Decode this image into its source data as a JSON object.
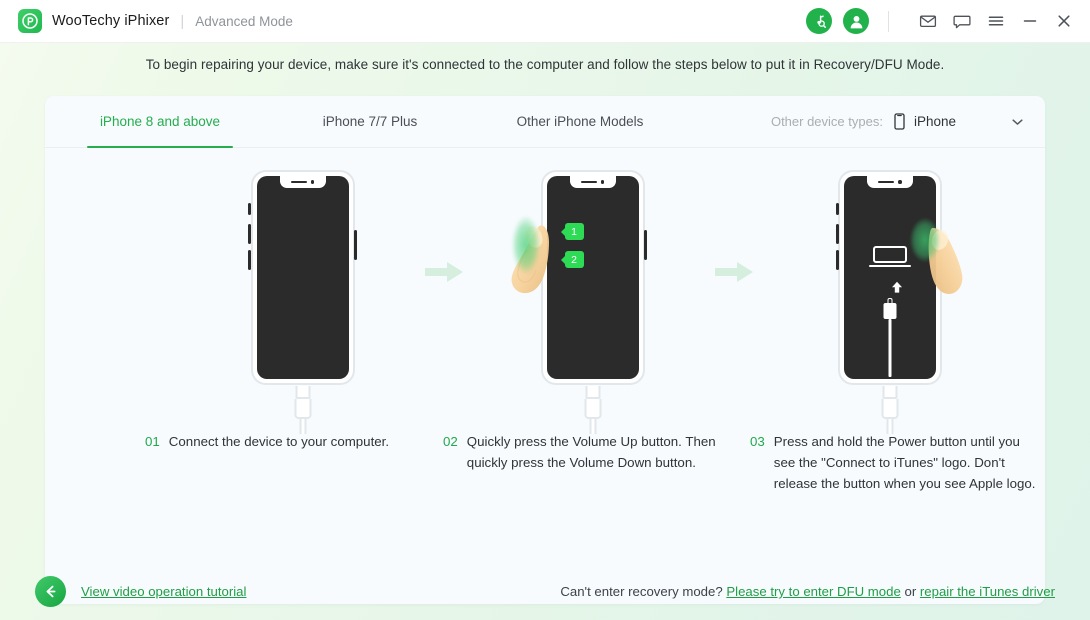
{
  "window": {
    "brand": "WooTechy iPhixer",
    "separator": "|",
    "mode": "Advanced Mode",
    "icons": {
      "logo": "wootechy-logo-icon",
      "music_search": "itunes-search-icon",
      "account": "user-account-icon",
      "mail": "mail-icon",
      "feedback": "feedback-chat-icon",
      "menu": "hamburger-menu-icon",
      "minimize": "minimize-icon",
      "close": "close-icon"
    }
  },
  "banner": {
    "text": "To begin repairing your device, make sure it's connected to the computer and follow the steps below to put it in Recovery/DFU Mode."
  },
  "tabs": [
    {
      "label": "iPhone 8 and above",
      "active": true
    },
    {
      "label": "iPhone 7/7 Plus",
      "active": false
    },
    {
      "label": "Other iPhone Models",
      "active": false
    }
  ],
  "device_select": {
    "label": "Other device types:",
    "value": "iPhone",
    "icon": "phone-outline-icon",
    "caret": "chevron-down-icon"
  },
  "steps": [
    {
      "number": "01",
      "text": "Connect the device to your computer."
    },
    {
      "number": "02",
      "text": "Quickly press the Volume Up button. Then quickly press the Volume Down button.",
      "badges": [
        "1",
        "2"
      ]
    },
    {
      "number": "03",
      "text": "Press and hold the Power button until you see the \"Connect to iTunes\" logo. Don't release the button when you see Apple logo."
    }
  ],
  "footer": {
    "back_icon": "back-arrow-icon",
    "video_link": "View video operation tutorial",
    "recovery_question": "Can't enter recovery mode?",
    "dfu_link": "Please try to enter DFU mode",
    "or_text": "or",
    "itunes_link": "repair the iTunes driver"
  },
  "colors": {
    "accent_green": "#22a94d",
    "link_green": "#1f9e45",
    "badge_green": "#2ddb55",
    "screen_dark": "#2b2b2b",
    "card_bg": "#f7fbfe",
    "body_gradient_start": "#f4fbef",
    "body_gradient_end": "#dff3ea"
  }
}
